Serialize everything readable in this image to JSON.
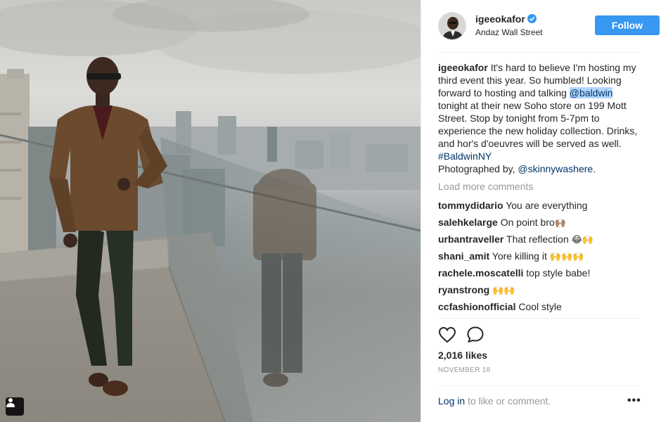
{
  "post": {
    "username": "igeeokafor",
    "location": "Andaz Wall Street",
    "follow_label": "Follow",
    "caption": {
      "author": "igeeokafor",
      "part1": " It's hard to believe I'm hosting my third event this year. So humbled! Looking forward to hosting and talking ",
      "mention": "@baldwin",
      "part2": " tonight at their new Soho store on 199 Mott Street. Stop by tonight from 5-7pm to experience the new holiday collection. Drinks, and hor's d'oeuvres will be served as well. ",
      "hashtag": "#BaldwinNY",
      "credit_prefix": "Photographed by, ",
      "credit_mention": "@skinnywashere",
      "credit_suffix": "."
    },
    "load_more": "Load more comments",
    "comments": [
      {
        "user": "tommydidario",
        "text": "You are everything",
        "emoji": ""
      },
      {
        "user": "salehkelarge",
        "text": "On point bro",
        "emoji": "🙌🏽"
      },
      {
        "user": "urbantraveller",
        "text": "That reflection",
        "emoji": "😂🙌"
      },
      {
        "user": "shani_amit",
        "text": "Yore killing it",
        "emoji": "🙌🙌🙌"
      },
      {
        "user": "rachele.moscatelli",
        "text": "top style babe!",
        "emoji": ""
      },
      {
        "user": "ryanstrong",
        "text": "",
        "emoji": "🙌🙌"
      },
      {
        "user": "ccfashionofficial",
        "text": "Cool style",
        "emoji": ""
      }
    ],
    "likes": "2,016 likes",
    "date": "NOVEMBER 18",
    "login": {
      "link": "Log in",
      "rest": " to like or comment."
    },
    "more_label": "•••"
  },
  "icons": {
    "heart": "heart-icon",
    "comment": "comment-bubble-icon",
    "tag": "user-tag-icon",
    "verified": "verified-badge-icon",
    "more": "more-options-icon"
  },
  "colors": {
    "accent": "#3897f0",
    "link": "#003569",
    "muted": "#999999",
    "mention_highlight": "#b2d7ff"
  }
}
